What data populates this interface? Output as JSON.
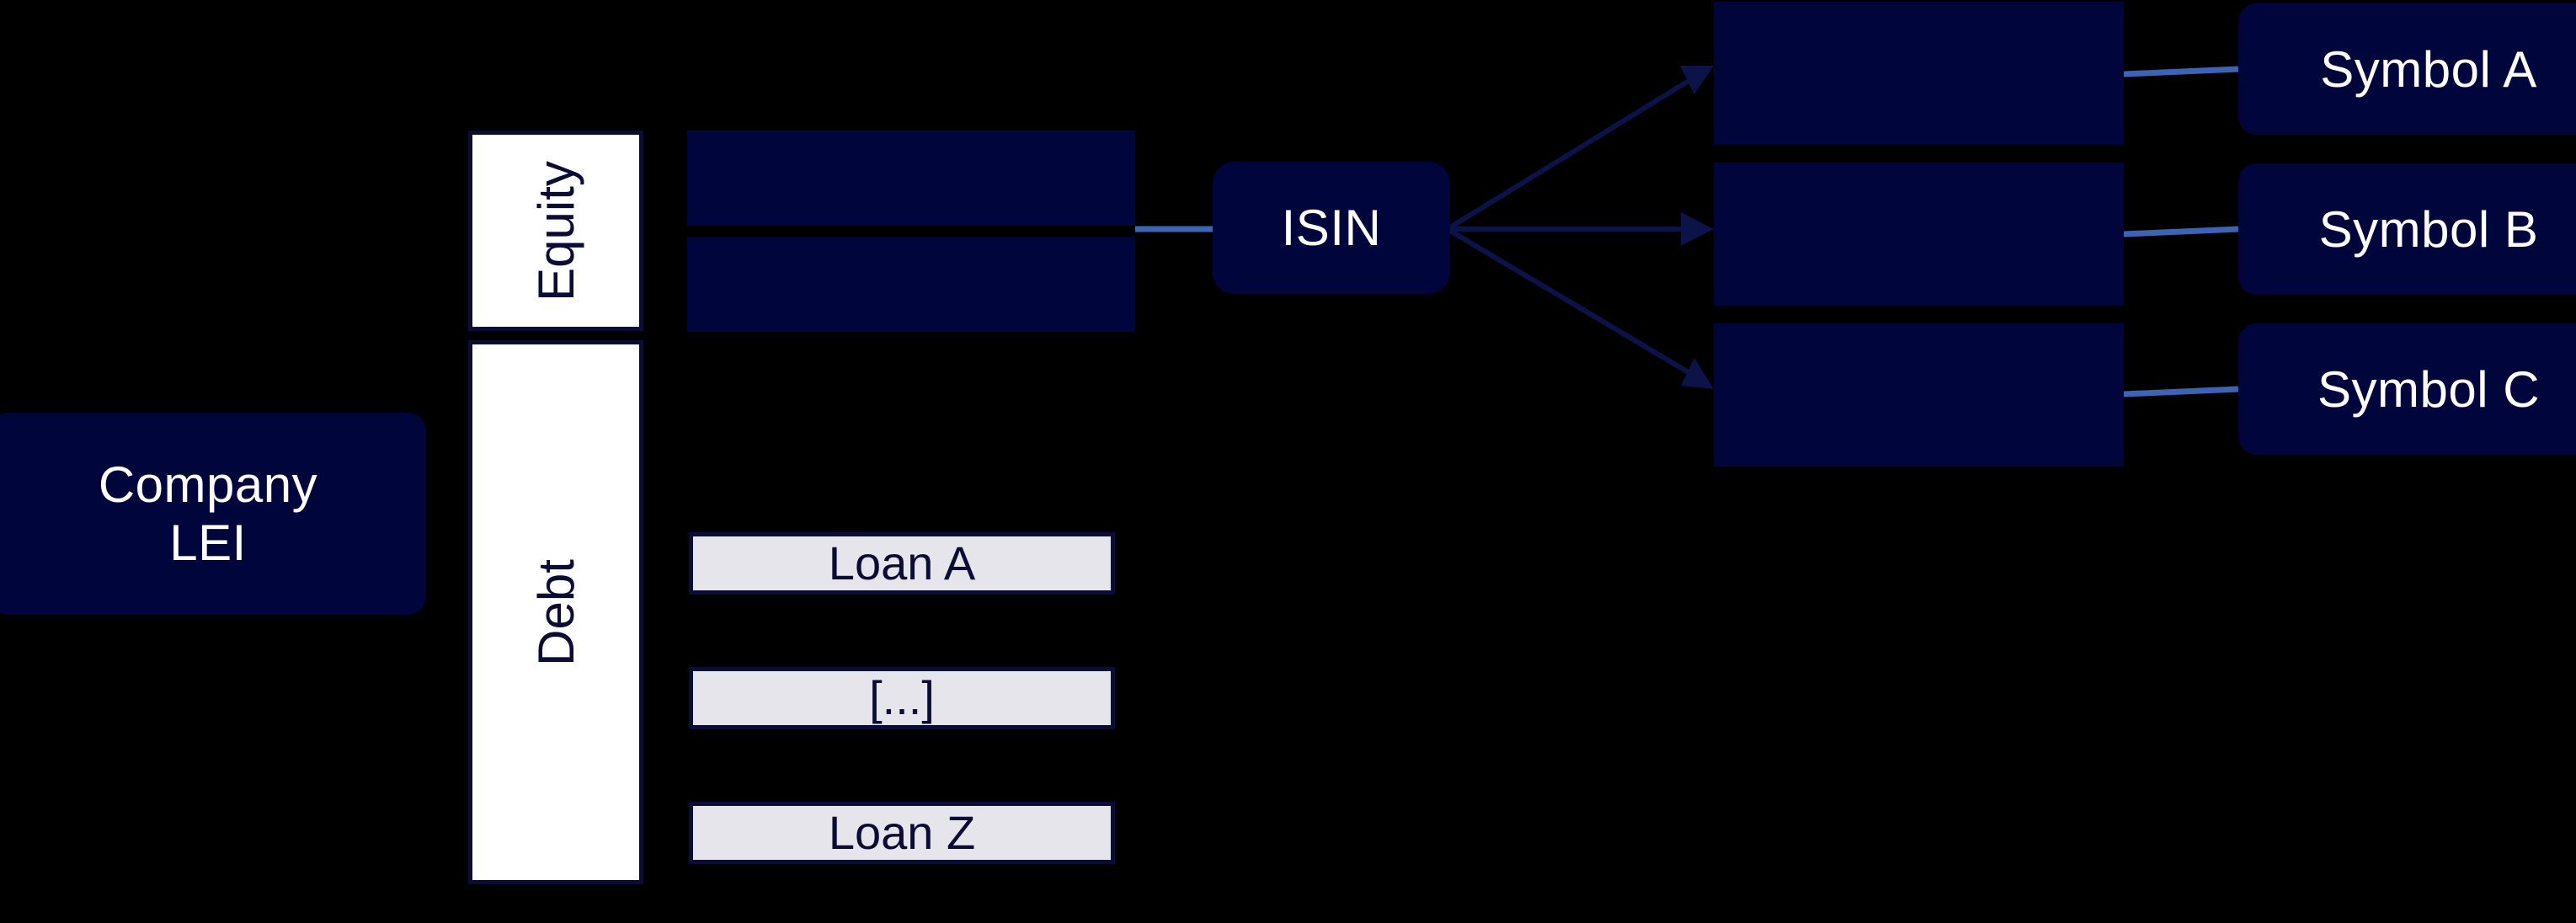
{
  "diagram": {
    "title": "Company LEI to instrument identifier hierarchy",
    "background_color": "#000000",
    "navy_color": "#00053c",
    "border_color": "#0b0b35",
    "grey_fill": "#e6e5ec",
    "white_fill": "#ffffff",
    "connector_color": "#3c63b4",
    "arrow_color": "#0b1348"
  },
  "company": {
    "line1": "Company",
    "line2": "LEI"
  },
  "categories": [
    {
      "label": "Equity"
    },
    {
      "label": "Debt"
    }
  ],
  "equity_instruments": [
    {
      "label": ""
    },
    {
      "label": ""
    }
  ],
  "debt_instruments": [
    {
      "label": "Loan A"
    },
    {
      "label": "[...]"
    },
    {
      "label": "Loan Z"
    }
  ],
  "isin": {
    "label": "ISIN"
  },
  "venues": [
    {
      "label": ""
    },
    {
      "label": ""
    },
    {
      "label": ""
    }
  ],
  "symbols": [
    {
      "label": "Symbol A"
    },
    {
      "label": "Symbol B"
    },
    {
      "label": "Symbol C"
    }
  ]
}
